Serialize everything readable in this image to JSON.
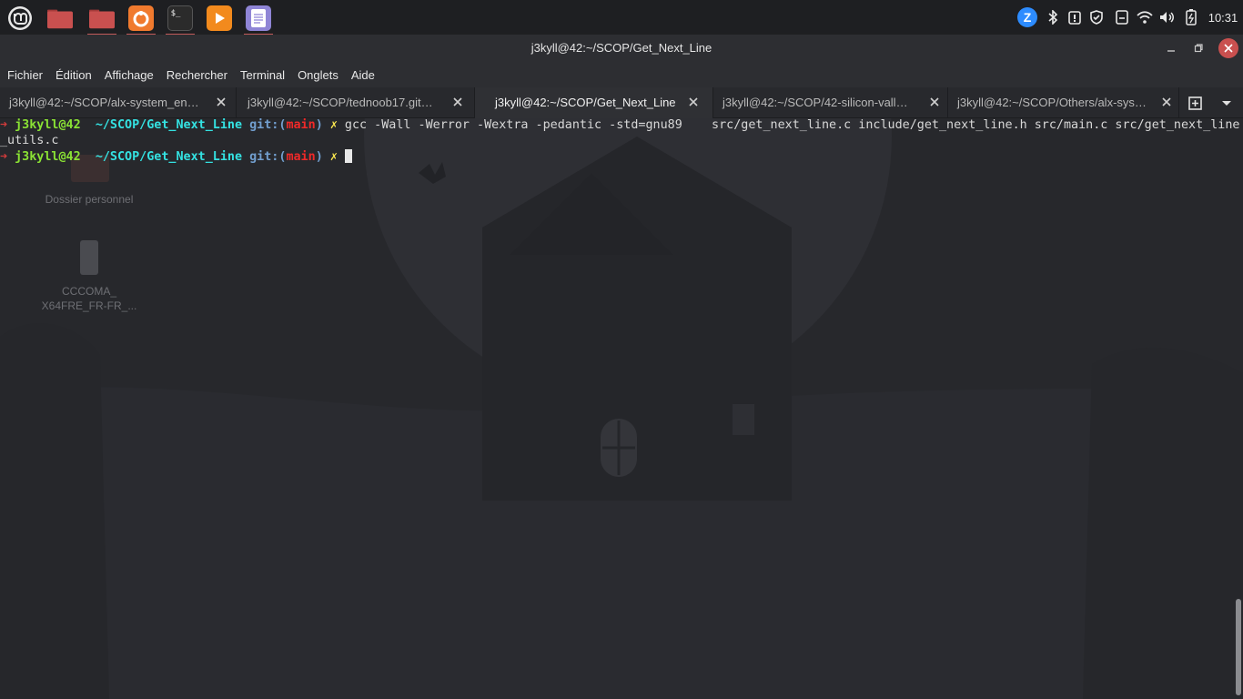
{
  "panel": {
    "launchers": [
      {
        "name": "mint-menu",
        "label": ""
      },
      {
        "name": "files-red",
        "label": ""
      },
      {
        "name": "files-active",
        "label": ""
      },
      {
        "name": "firefox",
        "label": ""
      },
      {
        "name": "terminal",
        "label": ""
      },
      {
        "name": "media-player",
        "label": ""
      },
      {
        "name": "text-editor",
        "label": ""
      }
    ],
    "tray": {
      "zoom_letter": "Z",
      "clock": "10:31"
    }
  },
  "window": {
    "title": "j3kyll@42:~/SCOP/Get_Next_Line",
    "menu": [
      "Fichier",
      "Édition",
      "Affichage",
      "Rechercher",
      "Terminal",
      "Onglets",
      "Aide"
    ],
    "tabs": [
      {
        "label": "j3kyll@42:~/SCOP/alx-system_en…",
        "active": false
      },
      {
        "label": "j3kyll@42:~/SCOP/tednoob17.git…",
        "active": false
      },
      {
        "label": "j3kyll@42:~/SCOP/Get_Next_Line",
        "active": true
      },
      {
        "label": "j3kyll@42:~/SCOP/42-silicon-vall…",
        "active": false
      },
      {
        "label": "j3kyll@42:~/SCOP/Others/alx-sys…",
        "active": false
      }
    ]
  },
  "terminal": {
    "prompt": {
      "arrow": "➜",
      "user": "j3kyll@42",
      "path": "~/SCOP/Get_Next_Line",
      "git": "git:(",
      "branch": "main",
      "git_close": ")",
      "dirty": "✗"
    },
    "command1": " gcc -Wall -Werror -Wextra -pedantic -std=gnu89    src/get_next_line.c include/get_next_line.h src/main.c src/get_next_line",
    "command1_wrap": "_utils.c"
  },
  "desktop": {
    "icons": [
      {
        "label": "Dossier personnel"
      },
      {
        "label": "CCCOMA_\nX64FRE_FR-FR_..."
      }
    ]
  },
  "colors": {
    "panel_bg": "#1e1f22",
    "window_bg": "#2d2e32",
    "terminal_bg": "#27282c",
    "accent_red": "#c25b5b"
  }
}
